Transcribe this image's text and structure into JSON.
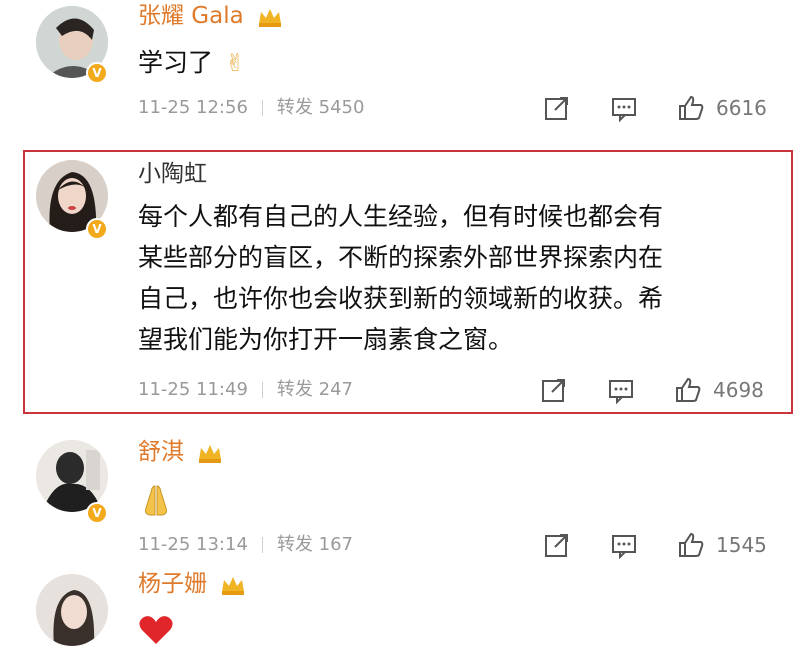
{
  "comments": [
    {
      "username": "张耀 Gala",
      "username_style": "member",
      "content": [
        "学习了"
      ],
      "content_emoji": "victory-hand",
      "date": "11-25 12:56",
      "repost": "转发 5450",
      "likes": "6616"
    },
    {
      "username": "小陶虹",
      "username_style": "plain",
      "content": [
        "每个人都有自己的人生经验，但有时候也都会有",
        "某些部分的盲区，不断的探索外部世界探索内在",
        "自己，也许你也会收获到新的领域新的收获。希",
        "望我们能为你打开一扇素食之窗。"
      ],
      "date": "11-25 11:49",
      "repost": "转发 247",
      "likes": "4698",
      "highlighted": true
    },
    {
      "username": "舒淇",
      "username_style": "member",
      "content_emoji": "folded-hands",
      "date": "11-25 13:14",
      "repost": "转发 167",
      "likes": "1545"
    },
    {
      "username": "杨子姗",
      "username_style": "member",
      "content_emoji": "red-heart"
    }
  ],
  "colors": {
    "member_name": "#e07a2b",
    "highlight_border": "#c9343c",
    "verified_badge": "#f2a91a",
    "meta_text": "#9a9a9a"
  }
}
